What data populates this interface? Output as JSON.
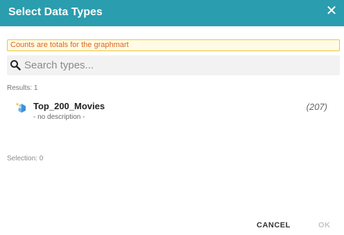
{
  "dialog": {
    "title": "Select Data Types",
    "close_label": "✕"
  },
  "notice": "Counts are totals for the graphmart",
  "search": {
    "placeholder": "Search types...",
    "value": ""
  },
  "results_label": "Results: 1",
  "types": [
    {
      "name": "Top_200_Movies",
      "description": "- no description -",
      "count": "(207)"
    }
  ],
  "selection_label": "Selection: 0",
  "actions": {
    "cancel_label": "CANCEL",
    "ok_label": "OK"
  },
  "colors": {
    "header": "#2a9dae",
    "notice_border": "#f0c23b",
    "notice_text": "#e0641a"
  }
}
